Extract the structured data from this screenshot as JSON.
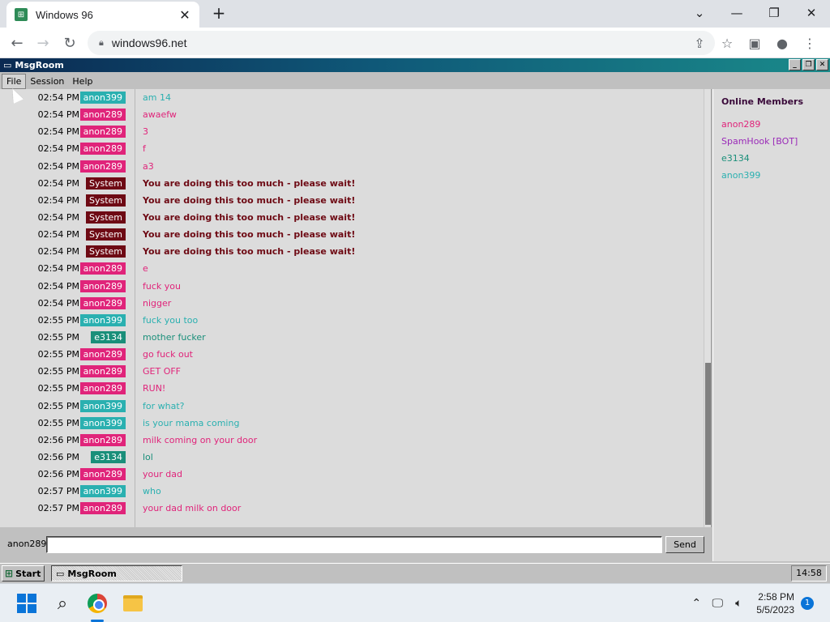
{
  "browser": {
    "tab_title": "Windows 96",
    "tab_icon": "windows96-favicon",
    "url": "windows96.net"
  },
  "app": {
    "title": "MsgRoom",
    "menu": [
      "File",
      "Session",
      "Help"
    ],
    "nick": "anon289",
    "send_label": "Send",
    "input_value": ""
  },
  "colors": {
    "anon399": "#2ab0b0",
    "anon289": "#e0247a",
    "System": "#6e0a14",
    "e3134": "#1a8f7a",
    "SpamHook [BOT]": "#9a2ab8"
  },
  "messages": [
    {
      "time": "02:54 PM",
      "user": "anon399",
      "text": "am 14"
    },
    {
      "time": "02:54 PM",
      "user": "anon289",
      "text": "awaefw"
    },
    {
      "time": "02:54 PM",
      "user": "anon289",
      "text": "3"
    },
    {
      "time": "02:54 PM",
      "user": "anon289",
      "text": "f"
    },
    {
      "time": "02:54 PM",
      "user": "anon289",
      "text": "a3"
    },
    {
      "time": "02:54 PM",
      "user": "System",
      "text": "You are doing this too much - please wait!"
    },
    {
      "time": "02:54 PM",
      "user": "System",
      "text": "You are doing this too much - please wait!"
    },
    {
      "time": "02:54 PM",
      "user": "System",
      "text": "You are doing this too much - please wait!"
    },
    {
      "time": "02:54 PM",
      "user": "System",
      "text": "You are doing this too much - please wait!"
    },
    {
      "time": "02:54 PM",
      "user": "System",
      "text": "You are doing this too much - please wait!"
    },
    {
      "time": "02:54 PM",
      "user": "anon289",
      "text": "e"
    },
    {
      "time": "02:54 PM",
      "user": "anon289",
      "text": "fuck you"
    },
    {
      "time": "02:54 PM",
      "user": "anon289",
      "text": "nigger"
    },
    {
      "time": "02:55 PM",
      "user": "anon399",
      "text": "fuck you too"
    },
    {
      "time": "02:55 PM",
      "user": "e3134",
      "text": "mother fucker"
    },
    {
      "time": "02:55 PM",
      "user": "anon289",
      "text": "go fuck out"
    },
    {
      "time": "02:55 PM",
      "user": "anon289",
      "text": "GET OFF"
    },
    {
      "time": "02:55 PM",
      "user": "anon289",
      "text": "RUN!"
    },
    {
      "time": "02:55 PM",
      "user": "anon399",
      "text": "for what?"
    },
    {
      "time": "02:55 PM",
      "user": "anon399",
      "text": "is your mama coming"
    },
    {
      "time": "02:56 PM",
      "user": "anon289",
      "text": "milk coming on your door"
    },
    {
      "time": "02:56 PM",
      "user": "e3134",
      "text": "lol"
    },
    {
      "time": "02:56 PM",
      "user": "anon289",
      "text": "your dad"
    },
    {
      "time": "02:57 PM",
      "user": "anon399",
      "text": "who"
    },
    {
      "time": "02:57 PM",
      "user": "anon289",
      "text": "your dad milk on door"
    }
  ],
  "members": {
    "title": "Online Members",
    "list": [
      "anon289",
      "SpamHook [BOT]",
      "e3134",
      "anon399"
    ]
  },
  "w96_taskbar": {
    "start_label": "Start",
    "task_label": "MsgRoom",
    "clock": "14:58"
  },
  "os_taskbar": {
    "time": "2:58 PM",
    "date": "5/5/2023",
    "notifications": "1"
  }
}
